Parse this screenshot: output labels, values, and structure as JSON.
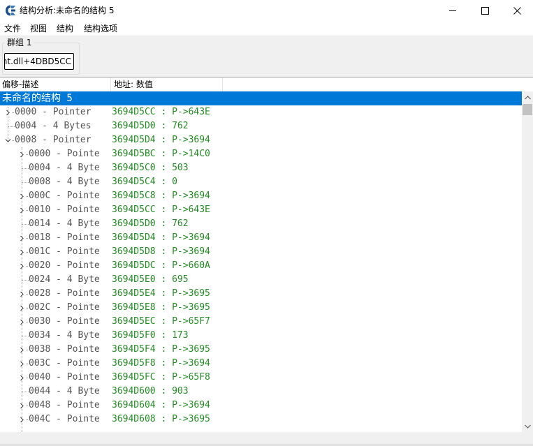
{
  "window": {
    "title": "结构分析:未命名的结构 5",
    "minimize_label": "",
    "colors": {
      "accent": "#0078d7",
      "address": "#228b22",
      "desc": "#555555"
    }
  },
  "menu": [
    "文件",
    "视图",
    "结构",
    "结构选项"
  ],
  "group": {
    "label": "群组 1",
    "address": "nt.dll+4DBD5CC"
  },
  "columns": {
    "offset": "偏移-描述",
    "address": "地址: 数值"
  },
  "root": "未命名的结构 5",
  "rows": [
    {
      "desc": "0000 - Pointer",
      "addr": "3694D5CC : P->643E",
      "level": 0,
      "expandable": true,
      "expanded": false
    },
    {
      "desc": "0004 - 4 Bytes",
      "addr": "3694D5D0 : 762",
      "level": 0,
      "expandable": false,
      "expanded": false
    },
    {
      "desc": "0008 - Pointer",
      "addr": "3694D5D4 : P->3694",
      "level": 0,
      "expandable": true,
      "expanded": true
    },
    {
      "desc": "0000 - Pointe",
      "addr": "3694D5BC : P->14C0",
      "level": 1,
      "expandable": true,
      "expanded": false
    },
    {
      "desc": "0004 - 4 Byte",
      "addr": "3694D5C0 : 503",
      "level": 1,
      "expandable": false,
      "expanded": false
    },
    {
      "desc": "0008 - 4 Byte",
      "addr": "3694D5C4 : 0",
      "level": 1,
      "expandable": false,
      "expanded": false
    },
    {
      "desc": "000C - Pointe",
      "addr": "3694D5C8 : P->3694",
      "level": 1,
      "expandable": true,
      "expanded": false
    },
    {
      "desc": "0010 - Pointe",
      "addr": "3694D5CC : P->643E",
      "level": 1,
      "expandable": true,
      "expanded": false
    },
    {
      "desc": "0014 - 4 Byte",
      "addr": "3694D5D0 : 762",
      "level": 1,
      "expandable": false,
      "expanded": false
    },
    {
      "desc": "0018 - Pointe",
      "addr": "3694D5D4 : P->3694",
      "level": 1,
      "expandable": true,
      "expanded": false
    },
    {
      "desc": "001C - Pointe",
      "addr": "3694D5D8 : P->3694",
      "level": 1,
      "expandable": true,
      "expanded": false
    },
    {
      "desc": "0020 - Pointe",
      "addr": "3694D5DC : P->660A",
      "level": 1,
      "expandable": true,
      "expanded": false
    },
    {
      "desc": "0024 - 4 Byte",
      "addr": "3694D5E0 : 695",
      "level": 1,
      "expandable": false,
      "expanded": false
    },
    {
      "desc": "0028 - Pointe",
      "addr": "3694D5E4 : P->3695",
      "level": 1,
      "expandable": true,
      "expanded": false
    },
    {
      "desc": "002C - Pointe",
      "addr": "3694D5E8 : P->3695",
      "level": 1,
      "expandable": true,
      "expanded": false
    },
    {
      "desc": "0030 - Pointe",
      "addr": "3694D5EC : P->65F7",
      "level": 1,
      "expandable": true,
      "expanded": false
    },
    {
      "desc": "0034 - 4 Byte",
      "addr": "3694D5F0 : 173",
      "level": 1,
      "expandable": false,
      "expanded": false
    },
    {
      "desc": "0038 - Pointe",
      "addr": "3694D5F4 : P->3695",
      "level": 1,
      "expandable": true,
      "expanded": false
    },
    {
      "desc": "003C - Pointe",
      "addr": "3694D5F8 : P->3694",
      "level": 1,
      "expandable": true,
      "expanded": false
    },
    {
      "desc": "0040 - Pointe",
      "addr": "3694D5FC : P->65F8",
      "level": 1,
      "expandable": true,
      "expanded": false
    },
    {
      "desc": "0044 - 4 Byte",
      "addr": "3694D600 : 903",
      "level": 1,
      "expandable": false,
      "expanded": false
    },
    {
      "desc": "0048 - Pointe",
      "addr": "3694D604 : P->3694",
      "level": 1,
      "expandable": true,
      "expanded": false
    },
    {
      "desc": "004C - Pointe",
      "addr": "3694D608 : P->3695",
      "level": 1,
      "expandable": true,
      "expanded": false
    }
  ],
  "icons": {
    "app": "cheat-engine-icon",
    "minimize": "minimize-icon",
    "maximize": "maximize-icon",
    "close": "close-icon",
    "collapsed": "chevron-right-icon",
    "expanded": "chevron-down-icon",
    "scroll_up": "scroll-up-arrow-icon",
    "scroll_down": "scroll-down-arrow-icon"
  }
}
